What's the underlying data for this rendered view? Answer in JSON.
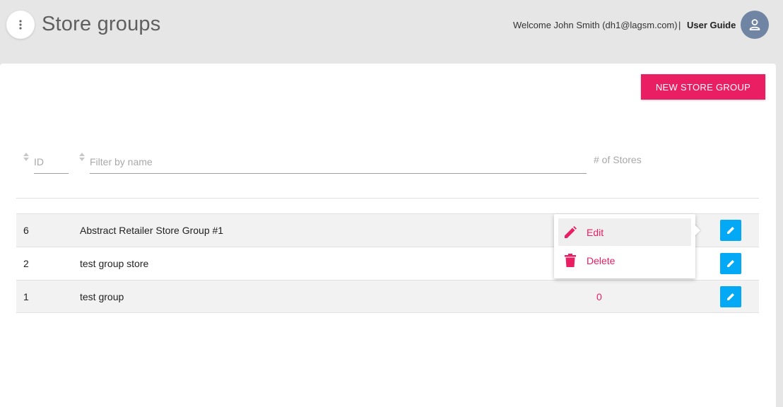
{
  "header": {
    "title": "Store groups",
    "welcome": "Welcome John Smith (dh1@lagsm.com)",
    "separator": "|",
    "user_guide": "User Guide"
  },
  "toolbar": {
    "new_label": "NEW STORE GROUP"
  },
  "filters": {
    "id_placeholder": "ID",
    "name_placeholder": "Filter by name",
    "stores_header": "# of Stores"
  },
  "rows": [
    {
      "id": "6",
      "name": "Abstract Retailer Store Group #1",
      "count": ""
    },
    {
      "id": "2",
      "name": "test group store",
      "count": ""
    },
    {
      "id": "1",
      "name": "test group",
      "count": "0"
    }
  ],
  "context_menu": {
    "edit": "Edit",
    "delete": "Delete"
  },
  "colors": {
    "accent": "#e91e63",
    "edit_button": "#03a9f4",
    "avatar": "#6f85a3"
  },
  "icons": [
    "more-vert-icon",
    "person-icon",
    "sort-icon",
    "pencil-icon",
    "trash-icon"
  ]
}
